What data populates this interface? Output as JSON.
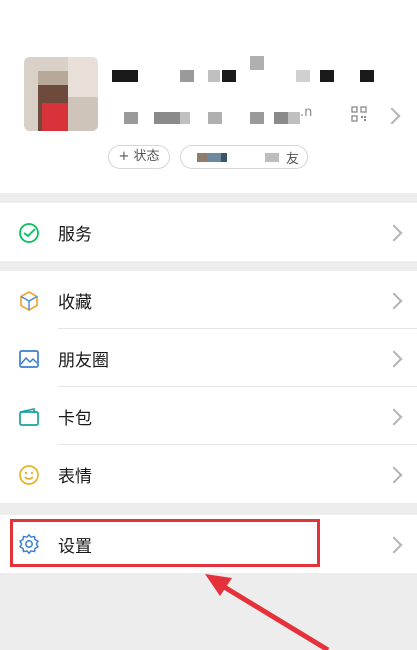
{
  "profile": {
    "id_suffix": ".n",
    "status_label": "+ 状态",
    "friend_char": "友"
  },
  "menu": {
    "services": {
      "label": "服务",
      "icon": "services-icon"
    },
    "favorites": {
      "label": "收藏",
      "icon": "favorites-icon"
    },
    "moments": {
      "label": "朋友圈",
      "icon": "moments-icon"
    },
    "cards": {
      "label": "卡包",
      "icon": "card-wallet-icon"
    },
    "stickers": {
      "label": "表情",
      "icon": "sticker-icon"
    },
    "settings": {
      "label": "设置",
      "icon": "gear-icon"
    }
  },
  "colors": {
    "accent_green": "#07c160",
    "highlight_red": "#e5323a"
  }
}
